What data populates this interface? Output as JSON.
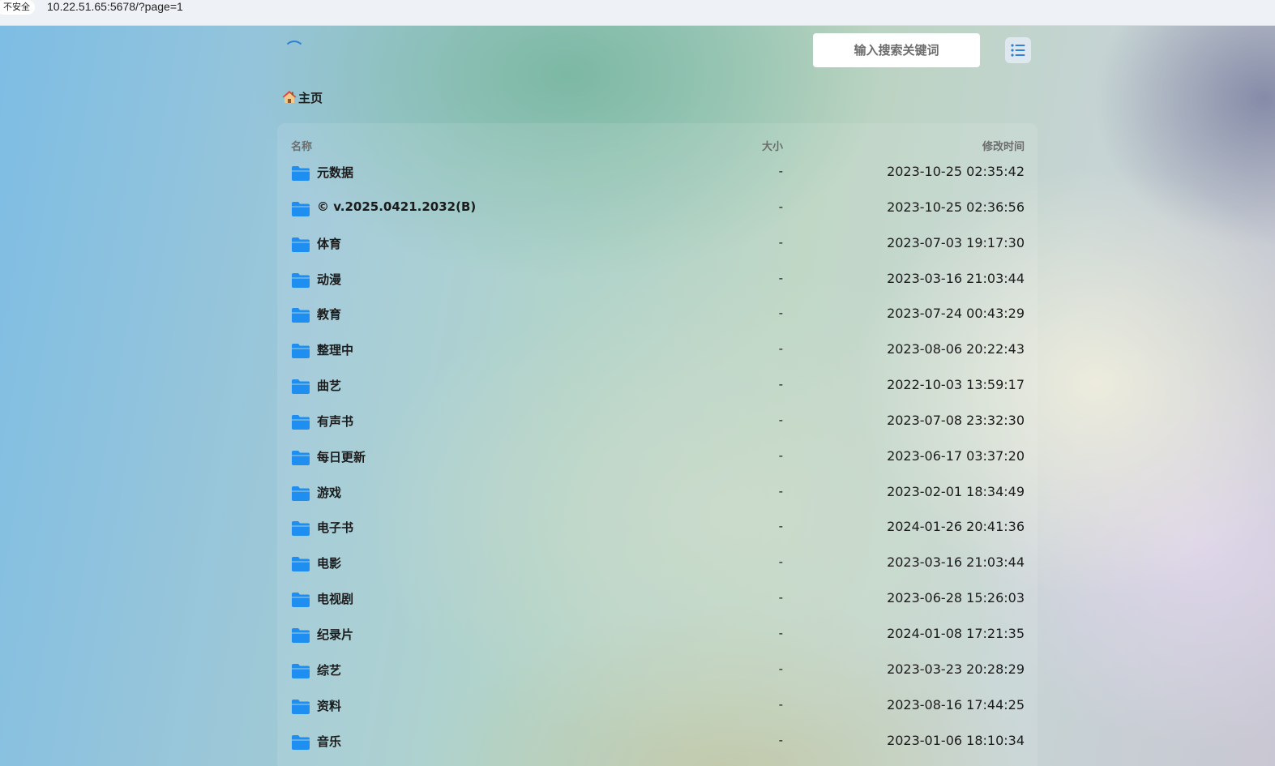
{
  "browser": {
    "security_label": "不安全",
    "url": "10.22.51.65:5678/?page=1"
  },
  "header": {
    "search_placeholder": "输入搜索关键词",
    "view_toggle_icon": "list-icon"
  },
  "breadcrumb": {
    "icon": "home-icon",
    "label": "主页"
  },
  "table": {
    "columns": {
      "name": "名称",
      "size": "大小",
      "modified": "修改时间"
    },
    "rows": [
      {
        "name": "元数据",
        "size": "-",
        "modified": "2023-10-25 02:35:42"
      },
      {
        "name": "© v.2025.0421.2032(B)",
        "size": "-",
        "modified": "2023-10-25 02:36:56"
      },
      {
        "name": "体育",
        "size": "-",
        "modified": "2023-07-03 19:17:30"
      },
      {
        "name": "动漫",
        "size": "-",
        "modified": "2023-03-16 21:03:44"
      },
      {
        "name": "教育",
        "size": "-",
        "modified": "2023-07-24 00:43:29"
      },
      {
        "name": "整理中",
        "size": "-",
        "modified": "2023-08-06 20:22:43"
      },
      {
        "name": "曲艺",
        "size": "-",
        "modified": "2022-10-03 13:59:17"
      },
      {
        "name": "有声书",
        "size": "-",
        "modified": "2023-07-08 23:32:30"
      },
      {
        "name": "每日更新",
        "size": "-",
        "modified": "2023-06-17 03:37:20"
      },
      {
        "name": "游戏",
        "size": "-",
        "modified": "2023-02-01 18:34:49"
      },
      {
        "name": "电子书",
        "size": "-",
        "modified": "2024-01-26 20:41:36"
      },
      {
        "name": "电影",
        "size": "-",
        "modified": "2023-03-16 21:03:44"
      },
      {
        "name": "电视剧",
        "size": "-",
        "modified": "2023-06-28 15:26:03"
      },
      {
        "name": "纪录片",
        "size": "-",
        "modified": "2024-01-08 17:21:35"
      },
      {
        "name": "综艺",
        "size": "-",
        "modified": "2023-03-23 20:28:29"
      },
      {
        "name": "资料",
        "size": "-",
        "modified": "2023-08-16 17:44:25"
      },
      {
        "name": "音乐",
        "size": "-",
        "modified": "2023-01-06 18:10:34"
      }
    ]
  },
  "colors": {
    "accent": "#2f80d6",
    "folder": "#1e8ff0",
    "text": "#1b1b1b",
    "muted": "#6d6d6d"
  }
}
